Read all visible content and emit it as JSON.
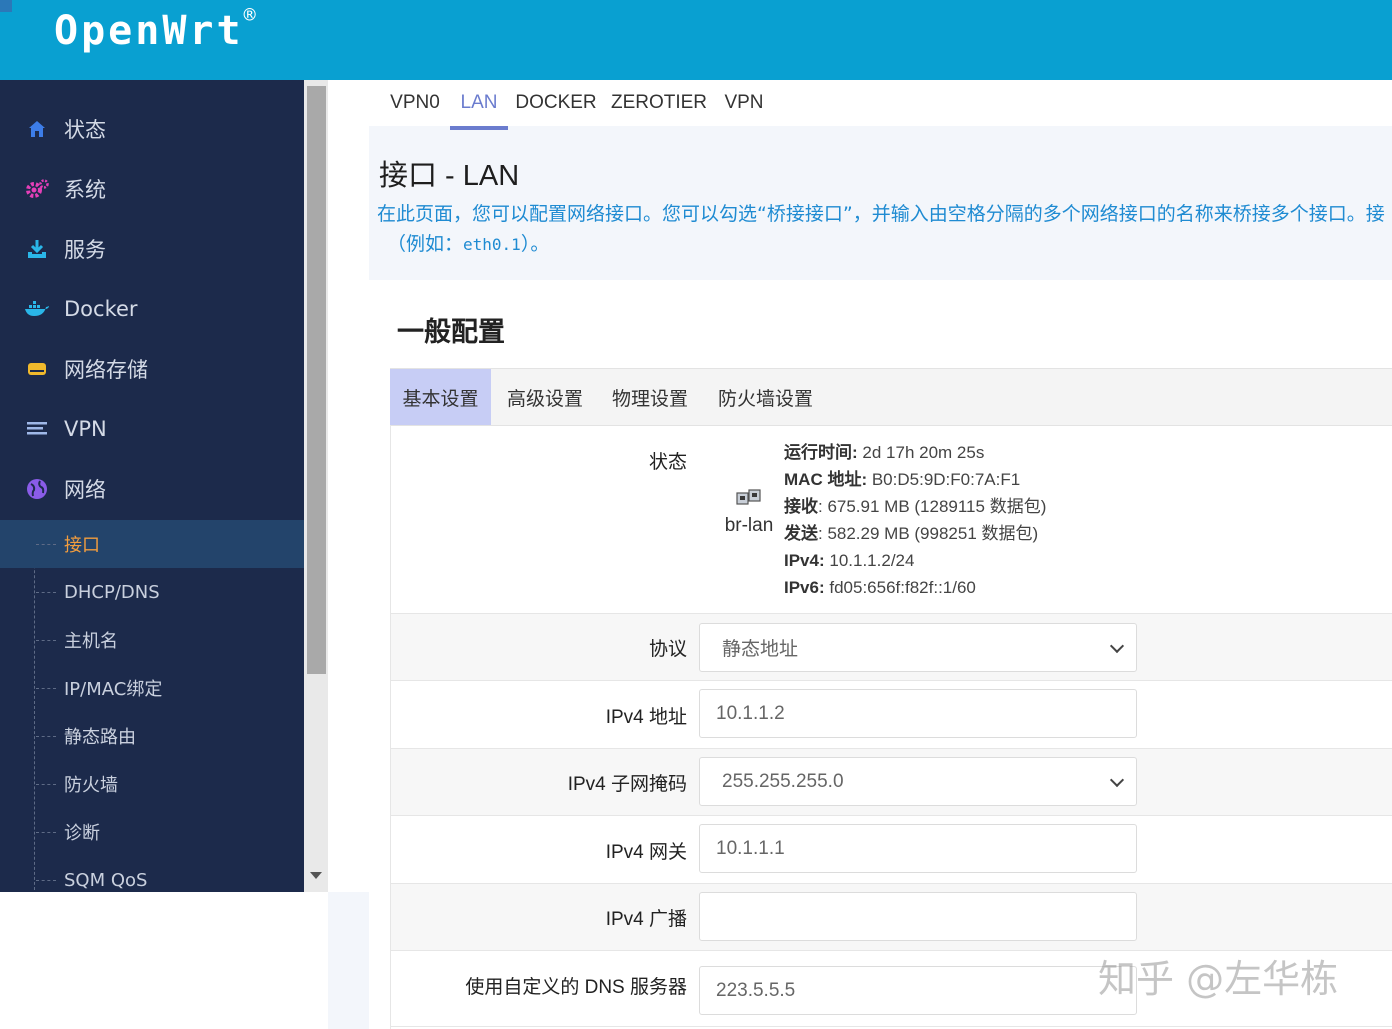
{
  "brand": {
    "name": "OpenWrt",
    "mark": "®"
  },
  "sidebar": {
    "items": [
      {
        "label": "状态",
        "icon": "home-icon"
      },
      {
        "label": "系统",
        "icon": "gears-icon"
      },
      {
        "label": "服务",
        "icon": "download-icon"
      },
      {
        "label": "Docker",
        "icon": "docker-whale-icon"
      },
      {
        "label": "网络存储",
        "icon": "storage-icon"
      },
      {
        "label": "VPN",
        "icon": "list-icon"
      },
      {
        "label": "网络",
        "icon": "globe-icon"
      }
    ],
    "subitems": [
      "接口",
      "DHCP/DNS",
      "主机名",
      "IP/MAC绑定",
      "静态路由",
      "防火墙",
      "诊断",
      "SQM QoS"
    ],
    "active_subitem": "接口"
  },
  "tabs": [
    {
      "label": "VPN0"
    },
    {
      "label": "LAN",
      "active": true
    },
    {
      "label": "DOCKER"
    },
    {
      "label": "ZEROTIER"
    },
    {
      "label": "VPN"
    }
  ],
  "page": {
    "title": "接口 - LAN",
    "description_line1": "在此页面，您可以配置网络接口。您可以勾选“桥接接口”，并输入由空格分隔的多个网络接口的名称来桥接多个接口。接",
    "description_line2_prefix": "（例如：",
    "description_line2_code": "eth0.1",
    "description_line2_suffix": "）。"
  },
  "section": {
    "title": "一般配置",
    "tabs": [
      "基本设置",
      "高级设置",
      "物理设置",
      "防火墙设置"
    ],
    "active_tab": "基本设置"
  },
  "status": {
    "label": "状态",
    "interface": "br-lan",
    "uptime_label": "运行时间:",
    "uptime": "2d 17h 20m 25s",
    "mac_label": "MAC 地址:",
    "mac": "B0:D5:9D:F0:7A:F1",
    "rx_label": "接收",
    "rx": ": 675.91 MB (1289115 数据包)",
    "tx_label": "发送",
    "tx": ": 582.29 MB (998251 数据包)",
    "ipv4_label": "IPv4:",
    "ipv4": "10.1.1.2/24",
    "ipv6_label": "IPv6:",
    "ipv6": "fd05:656f:f82f::1/60"
  },
  "form": {
    "protocol_label": "协议",
    "protocol_value": "静态地址",
    "ipv4_addr_label": "IPv4 地址",
    "ipv4_addr_value": "10.1.1.2",
    "netmask_label": "IPv4 子网掩码",
    "netmask_value": "255.255.255.0",
    "gateway_label": "IPv4 网关",
    "gateway_value": "10.1.1.1",
    "broadcast_label": "IPv4 广播",
    "broadcast_value": "",
    "dns_label": "使用自定义的 DNS 服务器",
    "dns_value": "223.5.5.5"
  },
  "watermark": "知乎 @左华栋",
  "colors": {
    "header": "#09a0d1",
    "sidebar": "#1c2a4b",
    "active_sub": "#f29d3e",
    "accent": "#6b7cce",
    "desc": "#1f8bd2"
  }
}
